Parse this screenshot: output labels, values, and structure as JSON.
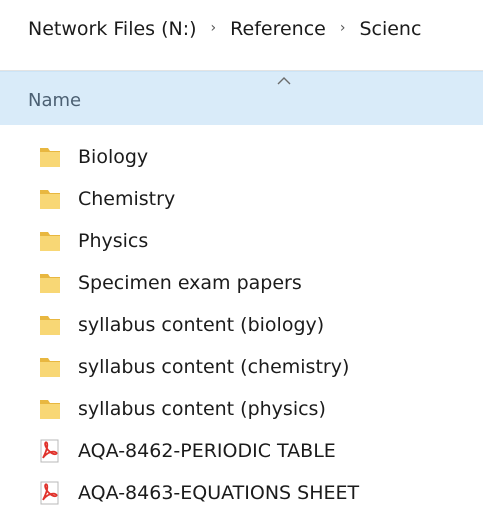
{
  "breadcrumb": {
    "items": [
      "Network Files (N:)",
      "Reference",
      "Scienc"
    ],
    "separator": "›"
  },
  "columns": {
    "name": "Name"
  },
  "files": [
    {
      "name": "Biology",
      "type": "folder"
    },
    {
      "name": "Chemistry",
      "type": "folder"
    },
    {
      "name": "Physics",
      "type": "folder"
    },
    {
      "name": "Specimen exam papers",
      "type": "folder"
    },
    {
      "name": "syllabus content (biology)",
      "type": "folder"
    },
    {
      "name": "syllabus content (chemistry)",
      "type": "folder"
    },
    {
      "name": "syllabus content (physics)",
      "type": "folder"
    },
    {
      "name": "AQA-8462-PERIODIC TABLE",
      "type": "pdf"
    },
    {
      "name": "AQA-8463-EQUATIONS SHEET",
      "type": "pdf"
    }
  ],
  "colors": {
    "folder": "#f8d775",
    "folder_dark": "#e8b740",
    "pdf": "#e0322b",
    "header_bg": "#d9ebf9"
  },
  "icons": {
    "folder": "folder-icon",
    "pdf": "pdf-icon",
    "sort": "sort-ascending-icon"
  }
}
